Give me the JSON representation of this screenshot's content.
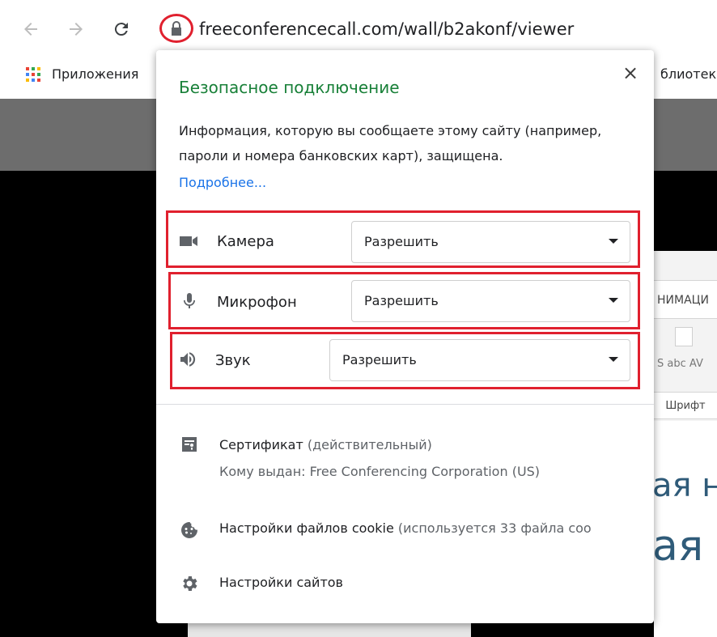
{
  "browser": {
    "url": "freeconferencecall.com/wall/b2akonf/viewer",
    "apps_label": "Приложения",
    "partial_bookmark": "блиотек"
  },
  "background": {
    "ribbon_tab": "НИМАЦИ",
    "font_group_label": "Шрифт",
    "doc_line1": "ая на",
    "doc_line2": "ая"
  },
  "popup": {
    "close_label": "×",
    "title": "Безопасное подключение",
    "description": "Информация, которую вы сообщаете этому сайту (например, пароли и номера банковских карт), защищена.",
    "more_link": "Подробнее...",
    "permissions": [
      {
        "label": "Камера",
        "value": "Разрешить",
        "icon": "camera-icon"
      },
      {
        "label": "Микрофон",
        "value": "Разрешить",
        "icon": "microphone-icon"
      },
      {
        "label": "Звук",
        "value": "Разрешить",
        "icon": "speaker-icon"
      }
    ],
    "certificate": {
      "title": "Сертификат",
      "status": "(действительный)",
      "issued_to": "Кому выдан: Free Conferencing Corporation (US)"
    },
    "cookies": {
      "title": "Настройки файлов cookie",
      "detail": "(используется 33 файла coo"
    },
    "site_settings": "Настройки сайтов"
  },
  "colors": {
    "accent_green": "#188038",
    "link_blue": "#1a73e8",
    "highlight_red": "#e0202e"
  }
}
